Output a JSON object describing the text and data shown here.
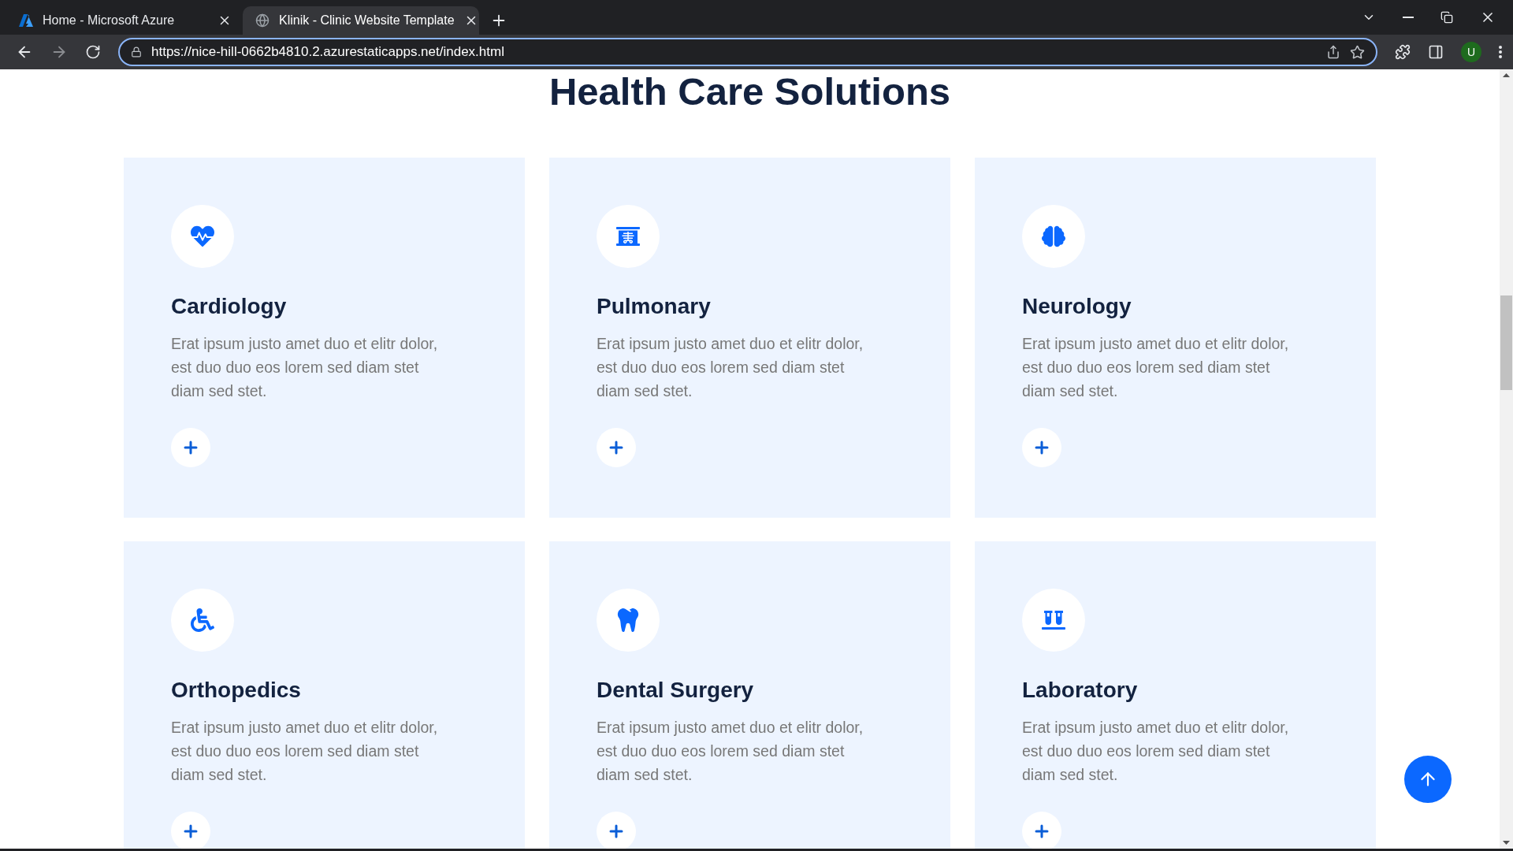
{
  "browser": {
    "tabs": [
      {
        "title": "Home - Microsoft Azure",
        "selected": false,
        "kind": "azure"
      },
      {
        "title": "Klinik - Clinic Website Template",
        "selected": true,
        "kind": "globe"
      }
    ],
    "url": "https://nice-hill-0662b4810.2.azurestaticapps.net/index.html",
    "profile": "U"
  },
  "page": {
    "heading": "Health Care Solutions",
    "services": [
      {
        "title": "Cardiology",
        "text": "Erat ipsum justo amet duo et elitr dolor, est duo duo eos lorem sed diam stet diam sed stet."
      },
      {
        "title": "Pulmonary",
        "text": "Erat ipsum justo amet duo et elitr dolor, est duo duo eos lorem sed diam stet diam sed stet."
      },
      {
        "title": "Neurology",
        "text": "Erat ipsum justo amet duo et elitr dolor, est duo duo eos lorem sed diam stet diam sed stet."
      },
      {
        "title": "Orthopedics",
        "text": "Erat ipsum justo amet duo et elitr dolor, est duo duo eos lorem sed diam stet diam sed stet."
      },
      {
        "title": "Dental Surgery",
        "text": "Erat ipsum justo amet duo et elitr dolor, est duo duo eos lorem sed diam stet diam sed stet."
      },
      {
        "title": "Laboratory",
        "text": "Erat ipsum justo amet duo et elitr dolor, est duo duo eos lorem sed diam stet diam sed stet."
      }
    ]
  }
}
